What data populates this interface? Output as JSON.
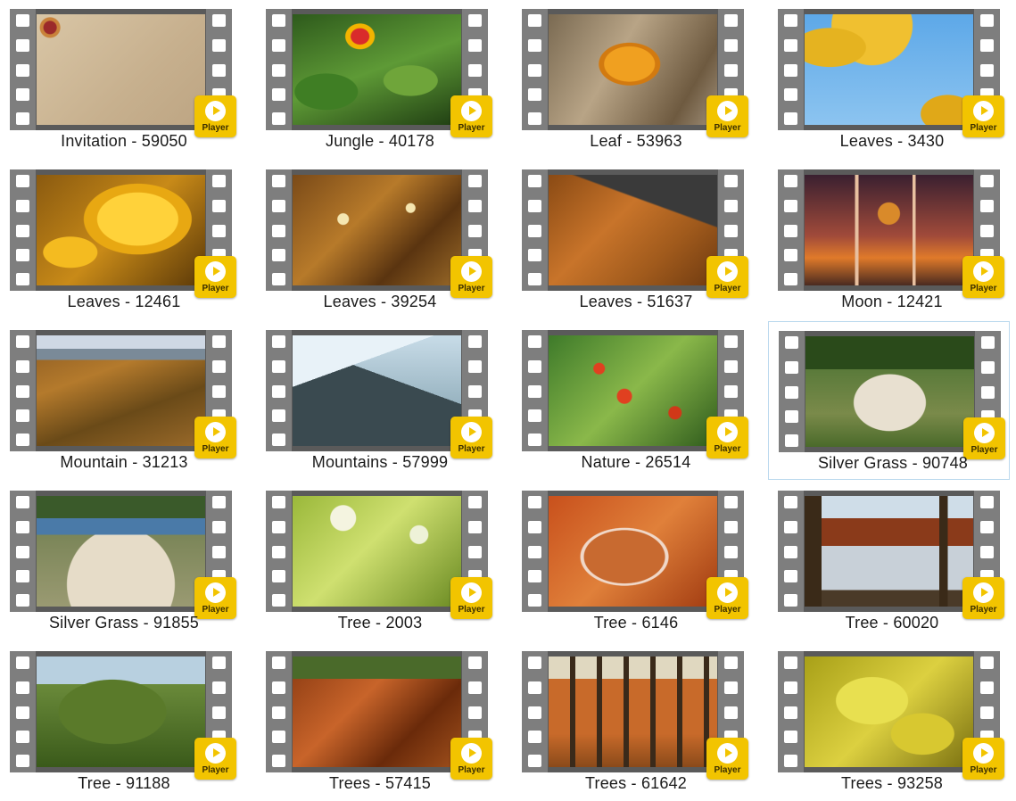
{
  "player_label": "Player",
  "selected_index": 11,
  "items": [
    {
      "title": "Invitation - 59050",
      "scene": "invitation"
    },
    {
      "title": "Jungle - 40178",
      "scene": "jungle"
    },
    {
      "title": "Leaf - 53963",
      "scene": "leaf"
    },
    {
      "title": "Leaves - 3430",
      "scene": "leaves-sky"
    },
    {
      "title": "Leaves - 12461",
      "scene": "maple-yellow"
    },
    {
      "title": "Leaves - 39254",
      "scene": "canopy-brown"
    },
    {
      "title": "Leaves - 51637",
      "scene": "leaves-ground"
    },
    {
      "title": "Moon - 12421",
      "scene": "moon-window"
    },
    {
      "title": "Mountain - 31213",
      "scene": "mountain-autumn"
    },
    {
      "title": "Mountains - 57999",
      "scene": "mountains-mist"
    },
    {
      "title": "Nature - 26514",
      "scene": "rowan-berries"
    },
    {
      "title": "Silver Grass - 90748",
      "scene": "silver-grass"
    },
    {
      "title": "Silver Grass - 91855",
      "scene": "silver-grass-river"
    },
    {
      "title": "Tree - 2003",
      "scene": "tree-bokeh"
    },
    {
      "title": "Tree - 6146",
      "scene": "frost-leaf"
    },
    {
      "title": "Tree - 60020",
      "scene": "lake-trees"
    },
    {
      "title": "Tree - 91188",
      "scene": "oak-tree"
    },
    {
      "title": "Trees - 57415",
      "scene": "forest-floor"
    },
    {
      "title": "Trees - 61642",
      "scene": "forest-trunks"
    },
    {
      "title": "Trees - 93258",
      "scene": "canopy-yellow"
    }
  ]
}
